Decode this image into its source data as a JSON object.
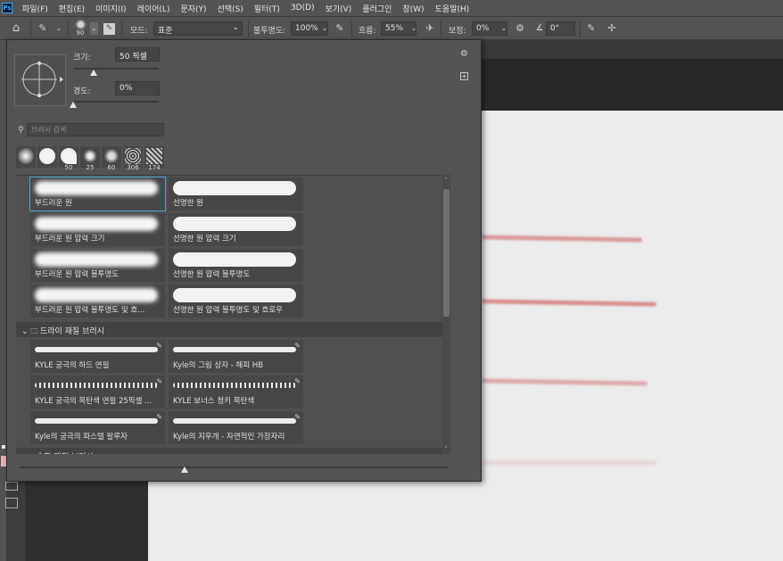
{
  "app": {
    "logo": "Ps"
  },
  "menu": [
    "파일(F)",
    "편집(E)",
    "이미지(I)",
    "레이어(L)",
    "문자(Y)",
    "선택(S)",
    "필터(T)",
    "3D(D)",
    "보기(V)",
    "플러그인",
    "창(W)",
    "도움말(H)"
  ],
  "options": {
    "brush_size": "90",
    "mode_label": "모드:",
    "mode_value": "표준",
    "opacity_label": "불투명도:",
    "opacity_value": "100%",
    "flow_label": "흐름:",
    "flow_value": "55%",
    "smoothing_label": "보정:",
    "smoothing_value": "0%",
    "angle_value": "0°"
  },
  "panel": {
    "size_label": "크기:",
    "size_value": "50 픽셀",
    "hardness_label": "경도:",
    "hardness_value": "0%",
    "search_placeholder": "브러시 검색",
    "presets": [
      "",
      "",
      "50",
      "25",
      "60",
      "306",
      "174"
    ],
    "brushes": [
      {
        "name": "부드러운 원",
        "type": "soft"
      },
      {
        "name": "선명한 원",
        "type": "hard"
      },
      {
        "name": "부드러운 원 압력 크기",
        "type": "soft"
      },
      {
        "name": "선명한 원 압력 크기",
        "type": "hard"
      },
      {
        "name": "부드러운 원 압력 불투명도",
        "type": "soft"
      },
      {
        "name": "선명한 원 압력 불투명도",
        "type": "hard"
      },
      {
        "name": "부드러운 원 압력 불투명도 및 흐...",
        "type": "soft"
      },
      {
        "name": "선명한 원 압력 불투명도 및 흐로우",
        "type": "hard"
      }
    ],
    "dry_group": "드라이 재질 브러시",
    "dry_brushes": [
      {
        "name": "KYLE 궁극의 하드 연필"
      },
      {
        "name": "Kyle의 그림 상자 - 해피 HB"
      },
      {
        "name": "KYLE 궁극의 목탄색 연필 25픽셀 ..."
      },
      {
        "name": "KYLE 보너스 청키 목탄색"
      },
      {
        "name": "Kyle의 궁극의 파스텔 팔루자"
      },
      {
        "name": "Kyle의 지우개 - 자연적인 가장자리"
      }
    ],
    "wet_group": "습한 재질 브러시"
  }
}
